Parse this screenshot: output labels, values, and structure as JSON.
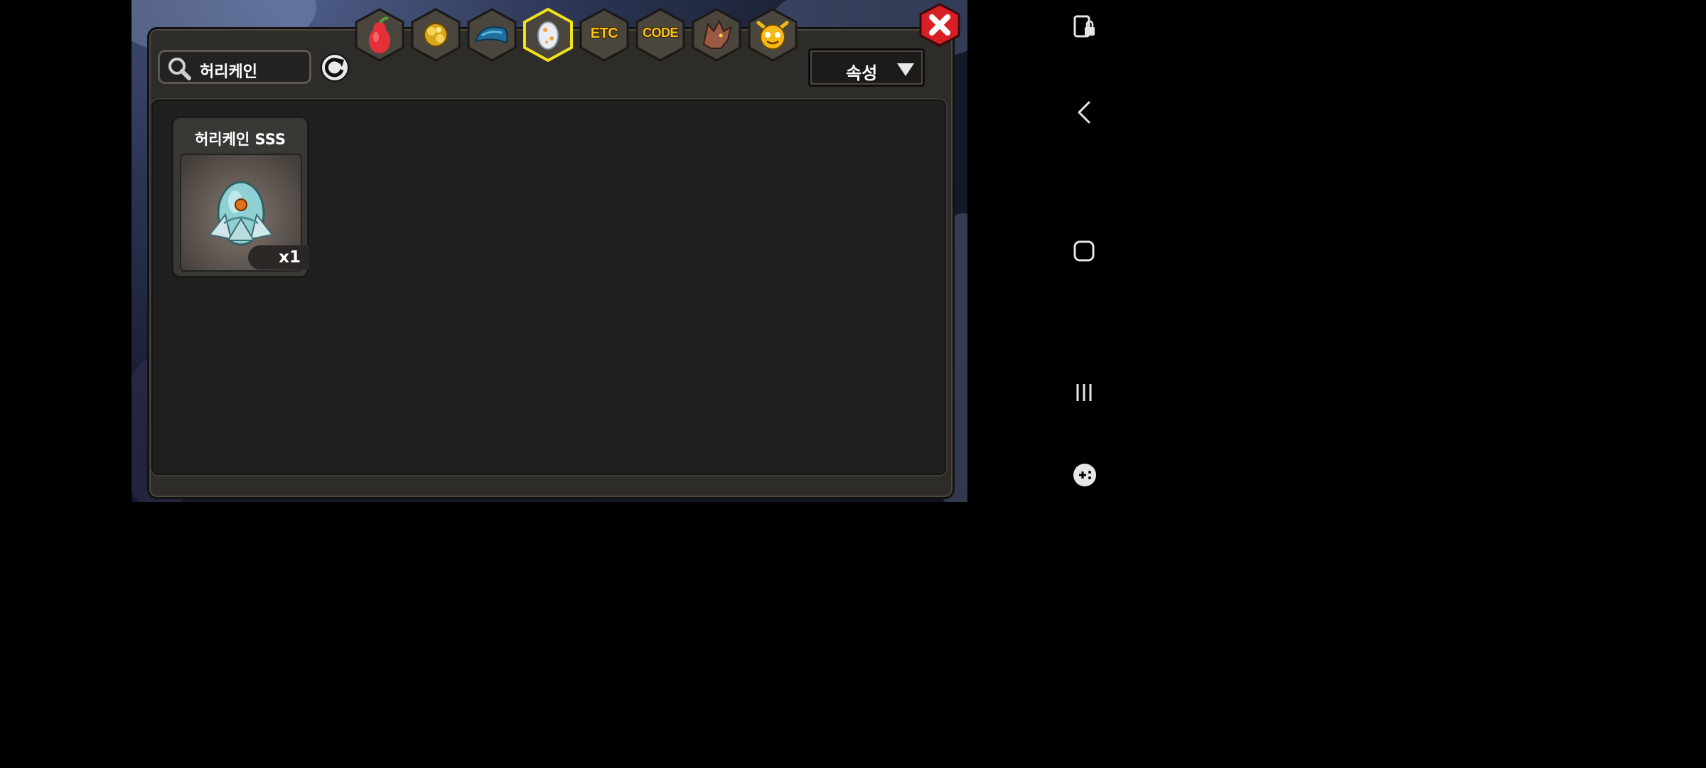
{
  "search": {
    "value": "허리케인",
    "icon": "search-icon"
  },
  "refresh": {
    "icon": "refresh-icon"
  },
  "tabs": [
    {
      "name": "fruit",
      "icon": "pear-icon",
      "label": "",
      "selected": false
    },
    {
      "name": "gold",
      "icon": "gold-icon",
      "label": "",
      "selected": false
    },
    {
      "name": "scale",
      "icon": "blue-scale-icon",
      "label": "",
      "selected": false
    },
    {
      "name": "egg",
      "icon": "egg-icon",
      "label": "",
      "selected": true
    },
    {
      "name": "etc",
      "icon": "",
      "label": "ETC",
      "selected": false
    },
    {
      "name": "code",
      "icon": "",
      "label": "CODE",
      "selected": false
    },
    {
      "name": "dragon",
      "icon": "dragon-head-icon",
      "label": "",
      "selected": false
    },
    {
      "name": "monster",
      "icon": "monster-face-icon",
      "label": "",
      "selected": false
    }
  ],
  "sort": {
    "label": "속성",
    "icon": "dropdown-triangle-icon"
  },
  "items": [
    {
      "name": "허리케인 SSS",
      "quantity": "x1",
      "icon": "hurricane-egg-icon"
    }
  ],
  "colors": {
    "selected_tab_border": "#f1e21a",
    "tab_label": "#f6c61a",
    "close_button": "#d81f26"
  }
}
